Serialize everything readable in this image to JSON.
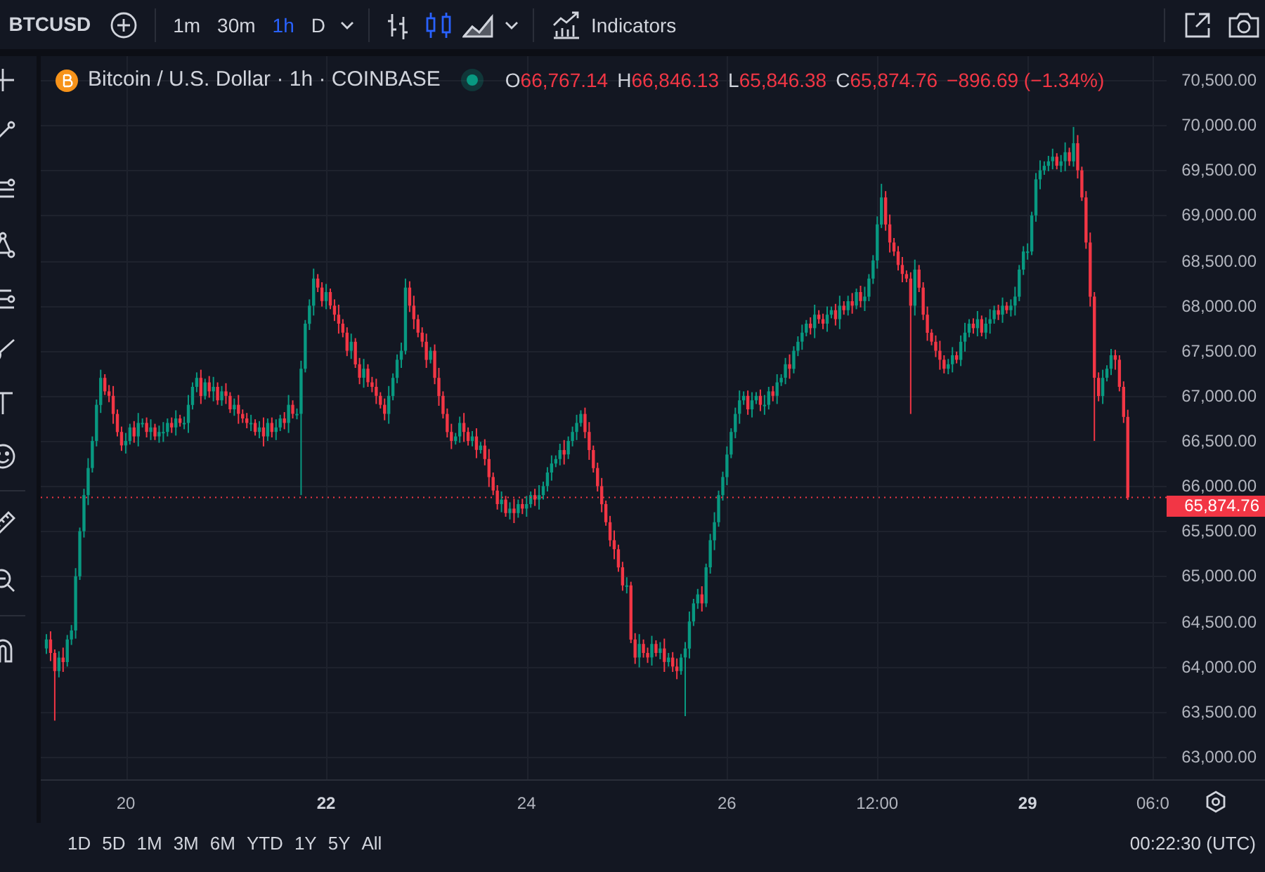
{
  "toolbar": {
    "symbol": "BTCUSD",
    "intervals": [
      {
        "label": "1m",
        "selected": false
      },
      {
        "label": "30m",
        "selected": false
      },
      {
        "label": "1h",
        "selected": true
      },
      {
        "label": "D",
        "selected": false
      }
    ],
    "chart_types": [
      {
        "kind": "bars",
        "selected": false
      },
      {
        "kind": "candles",
        "selected": true
      },
      {
        "kind": "area",
        "selected": false
      }
    ],
    "indicators_label": "Indicators"
  },
  "legend": {
    "title": "Bitcoin / U.S. Dollar · 1h · COINBASE",
    "ohlc": [
      {
        "label": "O",
        "value": "66,767.14"
      },
      {
        "label": "H",
        "value": "66,846.13"
      },
      {
        "label": "L",
        "value": "65,846.38"
      },
      {
        "label": "C",
        "value": "65,874.76"
      }
    ],
    "change": "−896.69 (−1.34%)"
  },
  "chart": {
    "last_price": "65,874.76",
    "bold_xticks": [
      false,
      true,
      false,
      false,
      false,
      true,
      false
    ],
    "chart_data": {
      "type": "candlestick",
      "ylim": [
        62750,
        70765
      ],
      "ref_lines": [
        {
          "axis": "y",
          "value": 65874.76,
          "color": "#f23645"
        }
      ],
      "categories": [
        null,
        null,
        null,
        null,
        null,
        null,
        null,
        null,
        null,
        null,
        null,
        null,
        null,
        null,
        null,
        null,
        null,
        null,
        null,
        "20",
        null,
        null,
        null,
        null,
        null,
        null,
        null,
        null,
        null,
        null,
        null,
        null,
        null,
        null,
        null,
        null,
        null,
        null,
        null,
        null,
        null,
        null,
        null,
        null,
        null,
        null,
        null,
        null,
        null,
        null,
        null,
        null,
        null,
        null,
        null,
        null,
        null,
        null,
        null,
        null,
        null,
        null,
        null,
        null,
        null,
        null,
        null,
        "22",
        null,
        null,
        null,
        null,
        null,
        null,
        null,
        null,
        null,
        null,
        null,
        null,
        null,
        null,
        null,
        null,
        null,
        null,
        null,
        null,
        null,
        null,
        null,
        null,
        null,
        null,
        null,
        null,
        null,
        null,
        null,
        null,
        null,
        null,
        null,
        null,
        null,
        null,
        null,
        null,
        null,
        null,
        null,
        null,
        null,
        null,
        null,
        "24",
        null,
        null,
        null,
        null,
        null,
        null,
        null,
        null,
        null,
        null,
        null,
        null,
        null,
        null,
        null,
        null,
        null,
        null,
        null,
        null,
        null,
        null,
        null,
        null,
        null,
        null,
        null,
        null,
        null,
        null,
        null,
        null,
        null,
        null,
        null,
        null,
        null,
        null,
        null,
        null,
        null,
        null,
        null,
        null,
        null,
        null,
        null,
        "26",
        null,
        null,
        null,
        null,
        null,
        null,
        null,
        null,
        null,
        null,
        null,
        null,
        null,
        null,
        null,
        null,
        null,
        null,
        null,
        null,
        null,
        null,
        null,
        null,
        null,
        null,
        null,
        null,
        null,
        null,
        null,
        null,
        null,
        null,
        null,
        "12:00",
        null,
        null,
        null,
        null,
        null,
        null,
        null,
        null,
        null,
        null,
        null,
        null,
        null,
        null,
        null,
        null,
        null,
        null,
        null,
        null,
        null,
        null,
        null,
        null,
        null,
        null,
        null,
        null,
        null,
        null,
        null,
        null,
        null,
        null,
        null,
        "29",
        null,
        null,
        null,
        null,
        null,
        null,
        null,
        null,
        null,
        null,
        null,
        null,
        null,
        null,
        null,
        null,
        null,
        null,
        null,
        null,
        null,
        null,
        null,
        null,
        null,
        null,
        null,
        null,
        null,
        "06:0"
      ],
      "yticks": [
        {
          "value": 70500,
          "label": "70,500.00"
        },
        {
          "value": 70000,
          "label": "70,000.00"
        },
        {
          "value": 69500,
          "label": "69,500.00"
        },
        {
          "value": 69000,
          "label": "69,000.00"
        },
        {
          "value": 68500,
          "label": "68,500.00"
        },
        {
          "value": 68000,
          "label": "68,000.00"
        },
        {
          "value": 67500,
          "label": "67,500.00"
        },
        {
          "value": 67000,
          "label": "67,000.00"
        },
        {
          "value": 66500,
          "label": "66,500.00"
        },
        {
          "value": 66000,
          "label": "66,000.00"
        },
        {
          "value": 65500,
          "label": "65,500.00"
        },
        {
          "value": 65000,
          "label": "65,000.00"
        },
        {
          "value": 64500,
          "label": "64,500.00"
        },
        {
          "value": 64000,
          "label": "64,000.00"
        },
        {
          "value": 63500,
          "label": "63,500.00"
        },
        {
          "value": 63000,
          "label": "63,000.00"
        }
      ],
      "ohlc": [
        [
          64200,
          64360,
          64140,
          64300
        ],
        [
          64300,
          64390,
          64060,
          64150
        ],
        [
          64150,
          64190,
          63400,
          63950
        ],
        [
          63950,
          64170,
          63880,
          64100
        ],
        [
          64100,
          64210,
          63940,
          64050
        ],
        [
          64050,
          64350,
          64000,
          64300
        ],
        [
          64300,
          64460,
          64240,
          64400
        ],
        [
          64400,
          65090,
          64310,
          65000
        ],
        [
          65000,
          65540,
          64960,
          65500
        ],
        [
          65500,
          65970,
          65430,
          65900
        ],
        [
          65900,
          66310,
          65790,
          66200
        ],
        [
          66200,
          66550,
          66150,
          66500
        ],
        [
          66500,
          66960,
          66440,
          66900
        ],
        [
          66900,
          67290,
          66810,
          67200
        ],
        [
          67200,
          67240,
          67010,
          67050
        ],
        [
          67050,
          67120,
          66930,
          67000
        ],
        [
          67000,
          67110,
          66690,
          66800
        ],
        [
          66800,
          66850,
          66550,
          66600
        ],
        [
          66600,
          66660,
          66390,
          66450
        ],
        [
          66450,
          66590,
          66360,
          66500
        ],
        [
          66500,
          66690,
          66460,
          66650
        ],
        [
          66650,
          66720,
          66480,
          66550
        ],
        [
          66550,
          66810,
          66440,
          66700
        ],
        [
          66700,
          66750,
          66650,
          66700
        ],
        [
          66700,
          66760,
          66540,
          66600
        ],
        [
          66600,
          66740,
          66510,
          66650
        ],
        [
          66650,
          66690,
          66510,
          66550
        ],
        [
          66550,
          66670,
          66480,
          66600
        ],
        [
          66600,
          66710,
          66490,
          66600
        ],
        [
          66600,
          66750,
          66550,
          66700
        ],
        [
          66700,
          66760,
          66590,
          66650
        ],
        [
          66650,
          66840,
          66560,
          66750
        ],
        [
          66750,
          66790,
          66660,
          66700
        ],
        [
          66700,
          66770,
          66630,
          66700
        ],
        [
          66700,
          67010,
          66590,
          66900
        ],
        [
          66900,
          67150,
          66850,
          67100
        ],
        [
          67100,
          67260,
          67040,
          67200
        ],
        [
          67200,
          67290,
          66910,
          67000
        ],
        [
          67000,
          67190,
          66960,
          67150
        ],
        [
          67150,
          67220,
          66980,
          67050
        ],
        [
          67050,
          67210,
          66940,
          67100
        ],
        [
          67100,
          67150,
          66900,
          66950
        ],
        [
          66950,
          67110,
          66890,
          67050
        ],
        [
          67050,
          67140,
          66910,
          67000
        ],
        [
          67000,
          67040,
          66810,
          66850
        ],
        [
          66850,
          66970,
          66780,
          66900
        ],
        [
          66900,
          67010,
          66690,
          66800
        ],
        [
          66800,
          66850,
          66700,
          66750
        ],
        [
          66750,
          66810,
          66640,
          66700
        ],
        [
          66700,
          66790,
          66610,
          66700
        ],
        [
          66700,
          66740,
          66560,
          66600
        ],
        [
          66600,
          66720,
          66530,
          66650
        ],
        [
          66650,
          66760,
          66440,
          66550
        ],
        [
          66550,
          66750,
          66500,
          66700
        ],
        [
          66700,
          66760,
          66540,
          66600
        ],
        [
          66600,
          66740,
          66510,
          66650
        ],
        [
          66650,
          66790,
          66610,
          66750
        ],
        [
          66750,
          66820,
          66630,
          66700
        ],
        [
          66700,
          67010,
          66590,
          66900
        ],
        [
          66900,
          66950,
          66750,
          66800
        ],
        [
          66800,
          66860,
          66740,
          66800
        ],
        [
          66800,
          67390,
          65900,
          67300
        ],
        [
          67300,
          67840,
          67260,
          67800
        ],
        [
          67800,
          68070,
          67730,
          68000
        ],
        [
          68000,
          68410,
          67890,
          68300
        ],
        [
          68300,
          68350,
          68150,
          68200
        ],
        [
          68200,
          68260,
          67990,
          68050
        ],
        [
          68050,
          68240,
          67960,
          68150
        ],
        [
          68150,
          68190,
          67960,
          68000
        ],
        [
          68000,
          68070,
          67830,
          67900
        ],
        [
          67900,
          68010,
          67690,
          67800
        ],
        [
          67800,
          67850,
          67650,
          67700
        ],
        [
          67700,
          67760,
          67440,
          67500
        ],
        [
          67500,
          67690,
          67410,
          67600
        ],
        [
          67600,
          67640,
          67310,
          67350
        ],
        [
          67350,
          67420,
          67130,
          67200
        ],
        [
          67200,
          67410,
          67090,
          67300
        ],
        [
          67300,
          67350,
          67100,
          67150
        ],
        [
          67150,
          67210,
          67040,
          67100
        ],
        [
          67100,
          67190,
          66910,
          67000
        ],
        [
          67000,
          67040,
          66860,
          66900
        ],
        [
          66900,
          66970,
          66730,
          66800
        ],
        [
          66800,
          67110,
          66690,
          67000
        ],
        [
          67000,
          67250,
          66950,
          67200
        ],
        [
          67200,
          67460,
          67140,
          67400
        ],
        [
          67400,
          67590,
          67310,
          67500
        ],
        [
          67500,
          68300,
          67460,
          68200
        ],
        [
          68200,
          68270,
          67930,
          68000
        ],
        [
          68000,
          68110,
          67740,
          67850
        ],
        [
          67850,
          67900,
          67650,
          67700
        ],
        [
          67700,
          67760,
          67540,
          67600
        ],
        [
          67600,
          67690,
          67310,
          67400
        ],
        [
          67400,
          67540,
          67360,
          67500
        ],
        [
          67500,
          67570,
          67130,
          67200
        ],
        [
          67200,
          67310,
          66890,
          67000
        ],
        [
          67000,
          67050,
          66750,
          66800
        ],
        [
          66800,
          66860,
          66540,
          66600
        ],
        [
          66600,
          66690,
          66410,
          66500
        ],
        [
          66500,
          66590,
          66460,
          66550
        ],
        [
          66550,
          66770,
          66480,
          66700
        ],
        [
          66700,
          66810,
          66490,
          66600
        ],
        [
          66600,
          66650,
          66450,
          66500
        ],
        [
          66500,
          66610,
          66440,
          66550
        ],
        [
          66550,
          66640,
          66310,
          66400
        ],
        [
          66400,
          66490,
          66360,
          66450
        ],
        [
          66450,
          66520,
          66230,
          66300
        ],
        [
          66300,
          66410,
          65990,
          66100
        ],
        [
          66100,
          66150,
          65900,
          65950
        ],
        [
          65950,
          66010,
          65740,
          65800
        ],
        [
          65800,
          65940,
          65710,
          65850
        ],
        [
          65850,
          65890,
          65660,
          65700
        ],
        [
          65700,
          65820,
          65630,
          65750
        ],
        [
          65750,
          65860,
          65590,
          65700
        ],
        [
          65700,
          65850,
          65650,
          65800
        ],
        [
          65800,
          65860,
          65690,
          65750
        ],
        [
          65750,
          65890,
          65660,
          65800
        ],
        [
          65800,
          65940,
          65760,
          65900
        ],
        [
          65900,
          65970,
          65780,
          65850
        ],
        [
          65850,
          66010,
          65740,
          65900
        ],
        [
          65900,
          66050,
          65850,
          66000
        ],
        [
          66000,
          66210,
          65940,
          66150
        ],
        [
          66150,
          66340,
          66060,
          66250
        ],
        [
          66250,
          66340,
          66210,
          66300
        ],
        [
          66300,
          66470,
          66230,
          66400
        ],
        [
          66400,
          66510,
          66240,
          66350
        ],
        [
          66350,
          66550,
          66300,
          66500
        ],
        [
          66500,
          66660,
          66440,
          66600
        ],
        [
          66600,
          66790,
          66510,
          66700
        ],
        [
          66700,
          66840,
          66660,
          66800
        ],
        [
          66800,
          66870,
          66530,
          66600
        ],
        [
          66600,
          66710,
          66290,
          66400
        ],
        [
          66400,
          66450,
          66150,
          66200
        ],
        [
          66200,
          66260,
          65940,
          66000
        ],
        [
          66000,
          66090,
          65710,
          65800
        ],
        [
          65800,
          65840,
          65560,
          65600
        ],
        [
          65600,
          65670,
          65330,
          65400
        ],
        [
          65400,
          65510,
          65190,
          65300
        ],
        [
          65300,
          65350,
          65050,
          65100
        ],
        [
          65100,
          65160,
          64840,
          64900
        ],
        [
          64900,
          64990,
          64810,
          64900
        ],
        [
          64900,
          64940,
          64260,
          64300
        ],
        [
          64300,
          64370,
          64030,
          64100
        ],
        [
          64100,
          64360,
          63990,
          64250
        ],
        [
          64250,
          64300,
          64100,
          64150
        ],
        [
          64150,
          64210,
          64040,
          64100
        ],
        [
          64100,
          64340,
          64010,
          64250
        ],
        [
          64250,
          64290,
          64110,
          64150
        ],
        [
          64150,
          64270,
          64080,
          64200
        ],
        [
          64200,
          64310,
          63940,
          64050
        ],
        [
          64050,
          64150,
          64000,
          64100
        ],
        [
          64100,
          64160,
          63940,
          64000
        ],
        [
          64000,
          64090,
          63860,
          63950
        ],
        [
          63950,
          64140,
          63910,
          64100
        ],
        [
          64100,
          64270,
          63450,
          64200
        ],
        [
          64200,
          64610,
          64090,
          64500
        ],
        [
          64500,
          64750,
          64450,
          64700
        ],
        [
          64700,
          64860,
          64640,
          64800
        ],
        [
          64800,
          64890,
          64610,
          64700
        ],
        [
          64700,
          65140,
          64660,
          65100
        ],
        [
          65100,
          65470,
          65030,
          65400
        ],
        [
          65400,
          65710,
          65290,
          65600
        ],
        [
          65600,
          65950,
          65550,
          65900
        ],
        [
          65900,
          66160,
          65840,
          66100
        ],
        [
          66100,
          66440,
          66010,
          66350
        ],
        [
          66350,
          66640,
          66310,
          66600
        ],
        [
          66600,
          66870,
          66530,
          66800
        ],
        [
          66800,
          67060,
          66690,
          66950
        ],
        [
          66950,
          67050,
          66900,
          67000
        ],
        [
          67000,
          67060,
          66790,
          66850
        ],
        [
          66850,
          67040,
          66760,
          66950
        ],
        [
          66950,
          67040,
          66910,
          67000
        ],
        [
          67000,
          67070,
          66830,
          66900
        ],
        [
          66900,
          67010,
          66790,
          66900
        ],
        [
          66900,
          67100,
          66850,
          67050
        ],
        [
          67050,
          67110,
          66940,
          67000
        ],
        [
          67000,
          67240,
          66910,
          67150
        ],
        [
          67150,
          67240,
          67110,
          67200
        ],
        [
          67200,
          67420,
          67130,
          67350
        ],
        [
          67350,
          67460,
          67190,
          67300
        ],
        [
          67300,
          67550,
          67250,
          67500
        ],
        [
          67500,
          67660,
          67440,
          67600
        ],
        [
          67600,
          67790,
          67510,
          67700
        ],
        [
          67700,
          67840,
          67660,
          67800
        ],
        [
          67800,
          67870,
          67680,
          67750
        ],
        [
          67750,
          68010,
          67640,
          67900
        ],
        [
          67900,
          67950,
          67800,
          67850
        ],
        [
          67850,
          67910,
          67740,
          67800
        ],
        [
          67800,
          67990,
          67710,
          67900
        ],
        [
          67900,
          67990,
          67860,
          67950
        ],
        [
          67950,
          68020,
          67780,
          67850
        ],
        [
          67850,
          68110,
          67740,
          68000
        ],
        [
          68000,
          68050,
          67900,
          67950
        ],
        [
          67950,
          68110,
          67890,
          68050
        ],
        [
          68050,
          68140,
          67910,
          68000
        ],
        [
          68000,
          68190,
          67960,
          68150
        ],
        [
          68150,
          68220,
          67980,
          68050
        ],
        [
          68050,
          68210,
          67940,
          68100
        ],
        [
          68100,
          68350,
          68050,
          68300
        ],
        [
          68300,
          68560,
          68240,
          68500
        ],
        [
          68500,
          68990,
          68410,
          68900
        ],
        [
          68900,
          69350,
          68860,
          69200
        ],
        [
          69200,
          69270,
          68830,
          68900
        ],
        [
          68900,
          69010,
          68590,
          68700
        ],
        [
          68700,
          68750,
          68550,
          68600
        ],
        [
          68600,
          68660,
          68390,
          68450
        ],
        [
          68450,
          68540,
          68260,
          68350
        ],
        [
          68350,
          68390,
          68260,
          68300
        ],
        [
          68300,
          68370,
          66800,
          68000
        ],
        [
          68000,
          68510,
          67890,
          68400
        ],
        [
          68400,
          68450,
          68150,
          68200
        ],
        [
          68200,
          68260,
          67840,
          67900
        ],
        [
          67900,
          67990,
          67610,
          67700
        ],
        [
          67700,
          67740,
          67560,
          67600
        ],
        [
          67600,
          67670,
          67430,
          67500
        ],
        [
          67500,
          67610,
          67290,
          67400
        ],
        [
          67400,
          67450,
          67250,
          67300
        ],
        [
          67300,
          67410,
          67240,
          67350
        ],
        [
          67350,
          67540,
          67260,
          67450
        ],
        [
          67450,
          67490,
          67360,
          67400
        ],
        [
          67400,
          67670,
          67330,
          67600
        ],
        [
          67600,
          67810,
          67490,
          67700
        ],
        [
          67700,
          67850,
          67650,
          67800
        ],
        [
          67800,
          67860,
          67690,
          67750
        ],
        [
          67750,
          67940,
          67660,
          67850
        ],
        [
          67850,
          67890,
          67660,
          67700
        ],
        [
          67700,
          67870,
          67630,
          67800
        ],
        [
          67800,
          67960,
          67690,
          67850
        ],
        [
          67850,
          68000,
          67800,
          67950
        ],
        [
          67950,
          68010,
          67840,
          67900
        ],
        [
          67900,
          68090,
          67810,
          68000
        ],
        [
          68000,
          68040,
          67910,
          67950
        ],
        [
          67950,
          68070,
          67880,
          68000
        ],
        [
          68000,
          68210,
          67890,
          68100
        ],
        [
          68100,
          68450,
          68050,
          68400
        ],
        [
          68400,
          68660,
          68340,
          68600
        ],
        [
          68600,
          68690,
          68510,
          68600
        ],
        [
          68600,
          69040,
          68560,
          69000
        ],
        [
          69000,
          69470,
          68930,
          69400
        ],
        [
          69400,
          69610,
          69290,
          69500
        ],
        [
          69500,
          69600,
          69450,
          69550
        ],
        [
          69550,
          69660,
          69490,
          69600
        ],
        [
          69600,
          69740,
          69510,
          69650
        ],
        [
          69650,
          69690,
          69510,
          69550
        ],
        [
          69550,
          69670,
          69480,
          69600
        ],
        [
          69600,
          69810,
          69490,
          69700
        ],
        [
          69700,
          69750,
          69550,
          69600
        ],
        [
          69600,
          69980,
          69540,
          69800
        ],
        [
          69800,
          69890,
          69410,
          69500
        ],
        [
          69500,
          69540,
          69160,
          69200
        ],
        [
          69200,
          69270,
          68630,
          68700
        ],
        [
          68700,
          68810,
          67990,
          68100
        ],
        [
          68100,
          68150,
          66500,
          67200
        ],
        [
          67200,
          67260,
          66940,
          67000
        ],
        [
          67000,
          67290,
          66910,
          67200
        ],
        [
          67200,
          67340,
          67160,
          67300
        ],
        [
          67300,
          67520,
          67230,
          67450
        ],
        [
          67450,
          67510,
          67290,
          67400
        ],
        [
          67400,
          67450,
          67050,
          67100
        ],
        [
          67100,
          67160,
          66700,
          66767.14
        ],
        [
          66767.14,
          66846.13,
          65846.38,
          65874.76
        ],
        null,
        null,
        null,
        null,
        null,
        null
      ]
    }
  },
  "range_buttons": [
    "1D",
    "5D",
    "1M",
    "3M",
    "6M",
    "YTD",
    "1Y",
    "5Y",
    "All"
  ],
  "clock": "00:22:30 (UTC)"
}
